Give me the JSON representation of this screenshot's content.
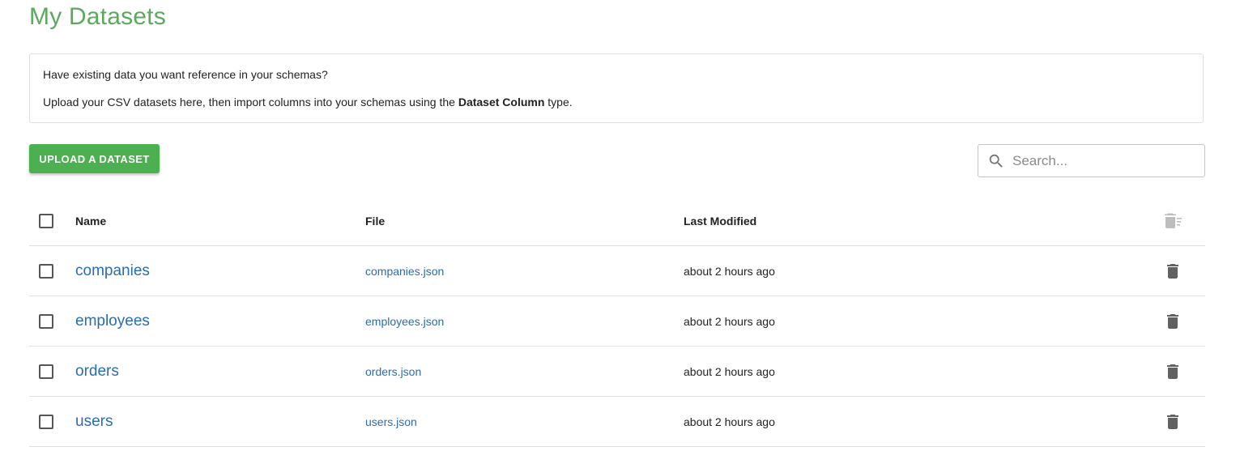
{
  "page": {
    "title": "My Datasets"
  },
  "info": {
    "line1": "Have existing data you want reference in your schemas?",
    "line2_prefix": "Upload your CSV datasets here, then import columns into your schemas using the ",
    "line2_bold": "Dataset Column",
    "line2_suffix": " type."
  },
  "toolbar": {
    "upload_label": "UPLOAD A DATASET"
  },
  "search": {
    "placeholder": "Search...",
    "value": "",
    "icon": "search-icon"
  },
  "table": {
    "headers": {
      "name": "Name",
      "file": "File",
      "modified": "Last Modified",
      "action_icon": "bulk-delete-icon"
    },
    "rows": [
      {
        "name": "companies",
        "file": "companies.json",
        "modified": "about 2 hours ago"
      },
      {
        "name": "employees",
        "file": "employees.json",
        "modified": "about 2 hours ago"
      },
      {
        "name": "orders",
        "file": "orders.json",
        "modified": "about 2 hours ago"
      },
      {
        "name": "users",
        "file": "users.json",
        "modified": "about 2 hours ago"
      }
    ]
  },
  "colors": {
    "title": "#5aaa5e",
    "primary_button": "#4caf50",
    "link": "#2a6cb0",
    "trash": "#616161",
    "trash_disabled": "#bdbdbd"
  }
}
